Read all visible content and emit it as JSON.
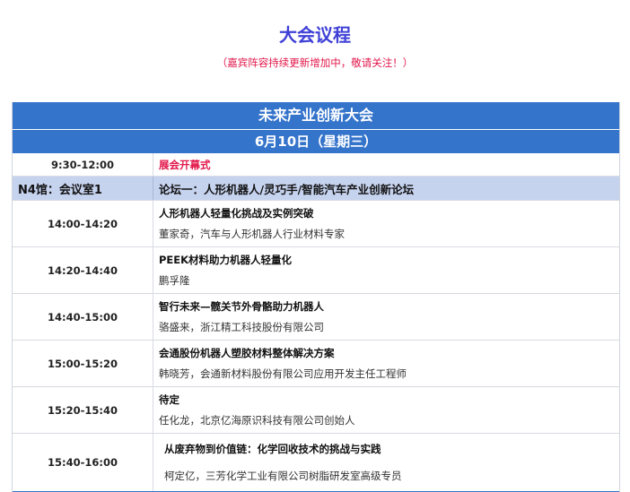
{
  "page": {
    "title": "大会议程",
    "subtitle": "（嘉宾阵容持续更新增加中，敬请关注！）"
  },
  "conference": {
    "name": "未来产业创新大会",
    "date": "6月10日（星期三）"
  },
  "opening": {
    "time": "9:30-12:00",
    "label": "展会开幕式"
  },
  "forum": {
    "venue": "N4馆：会议室1",
    "name": "论坛一：人形机器人/灵巧手/智能汽车产业创新论坛"
  },
  "sessions": [
    {
      "time": "14:00-14:20",
      "title": "人形机器人轻量化挑战及实例突破",
      "speaker": "董家奇，汽车与人形机器人行业材料专家"
    },
    {
      "time": "14:20-14:40",
      "title": "PEEK材料助力机器人轻量化",
      "speaker": "鹏孚隆"
    },
    {
      "time": "14:40-15:00",
      "title": "智行未来—髋关节外骨骼助力机器人",
      "speaker": "骆盛来，浙江精工科技股份有限公司"
    },
    {
      "time": "15:00-15:20",
      "title": "会通股份机器人塑胶材料整体解决方案",
      "speaker": "韩晓芳，会通新材料股份有限公司应用开发主任工程师"
    },
    {
      "time": "15:20-15:40",
      "title": "待定",
      "speaker": "任化龙，北京亿海原识科技有限公司创始人"
    },
    {
      "time": "15:40-16:00",
      "title": "从废弃物到价值链：化学回收技术的挑战与实践",
      "speaker": "柯定亿，三芳化学工业有限公司树脂研发室高级专员"
    }
  ],
  "colors": {
    "title": "#3f40d6",
    "accent_red": "#e2174a",
    "band_blue": "#3574cb",
    "forum_row": "#c6d3ef"
  }
}
